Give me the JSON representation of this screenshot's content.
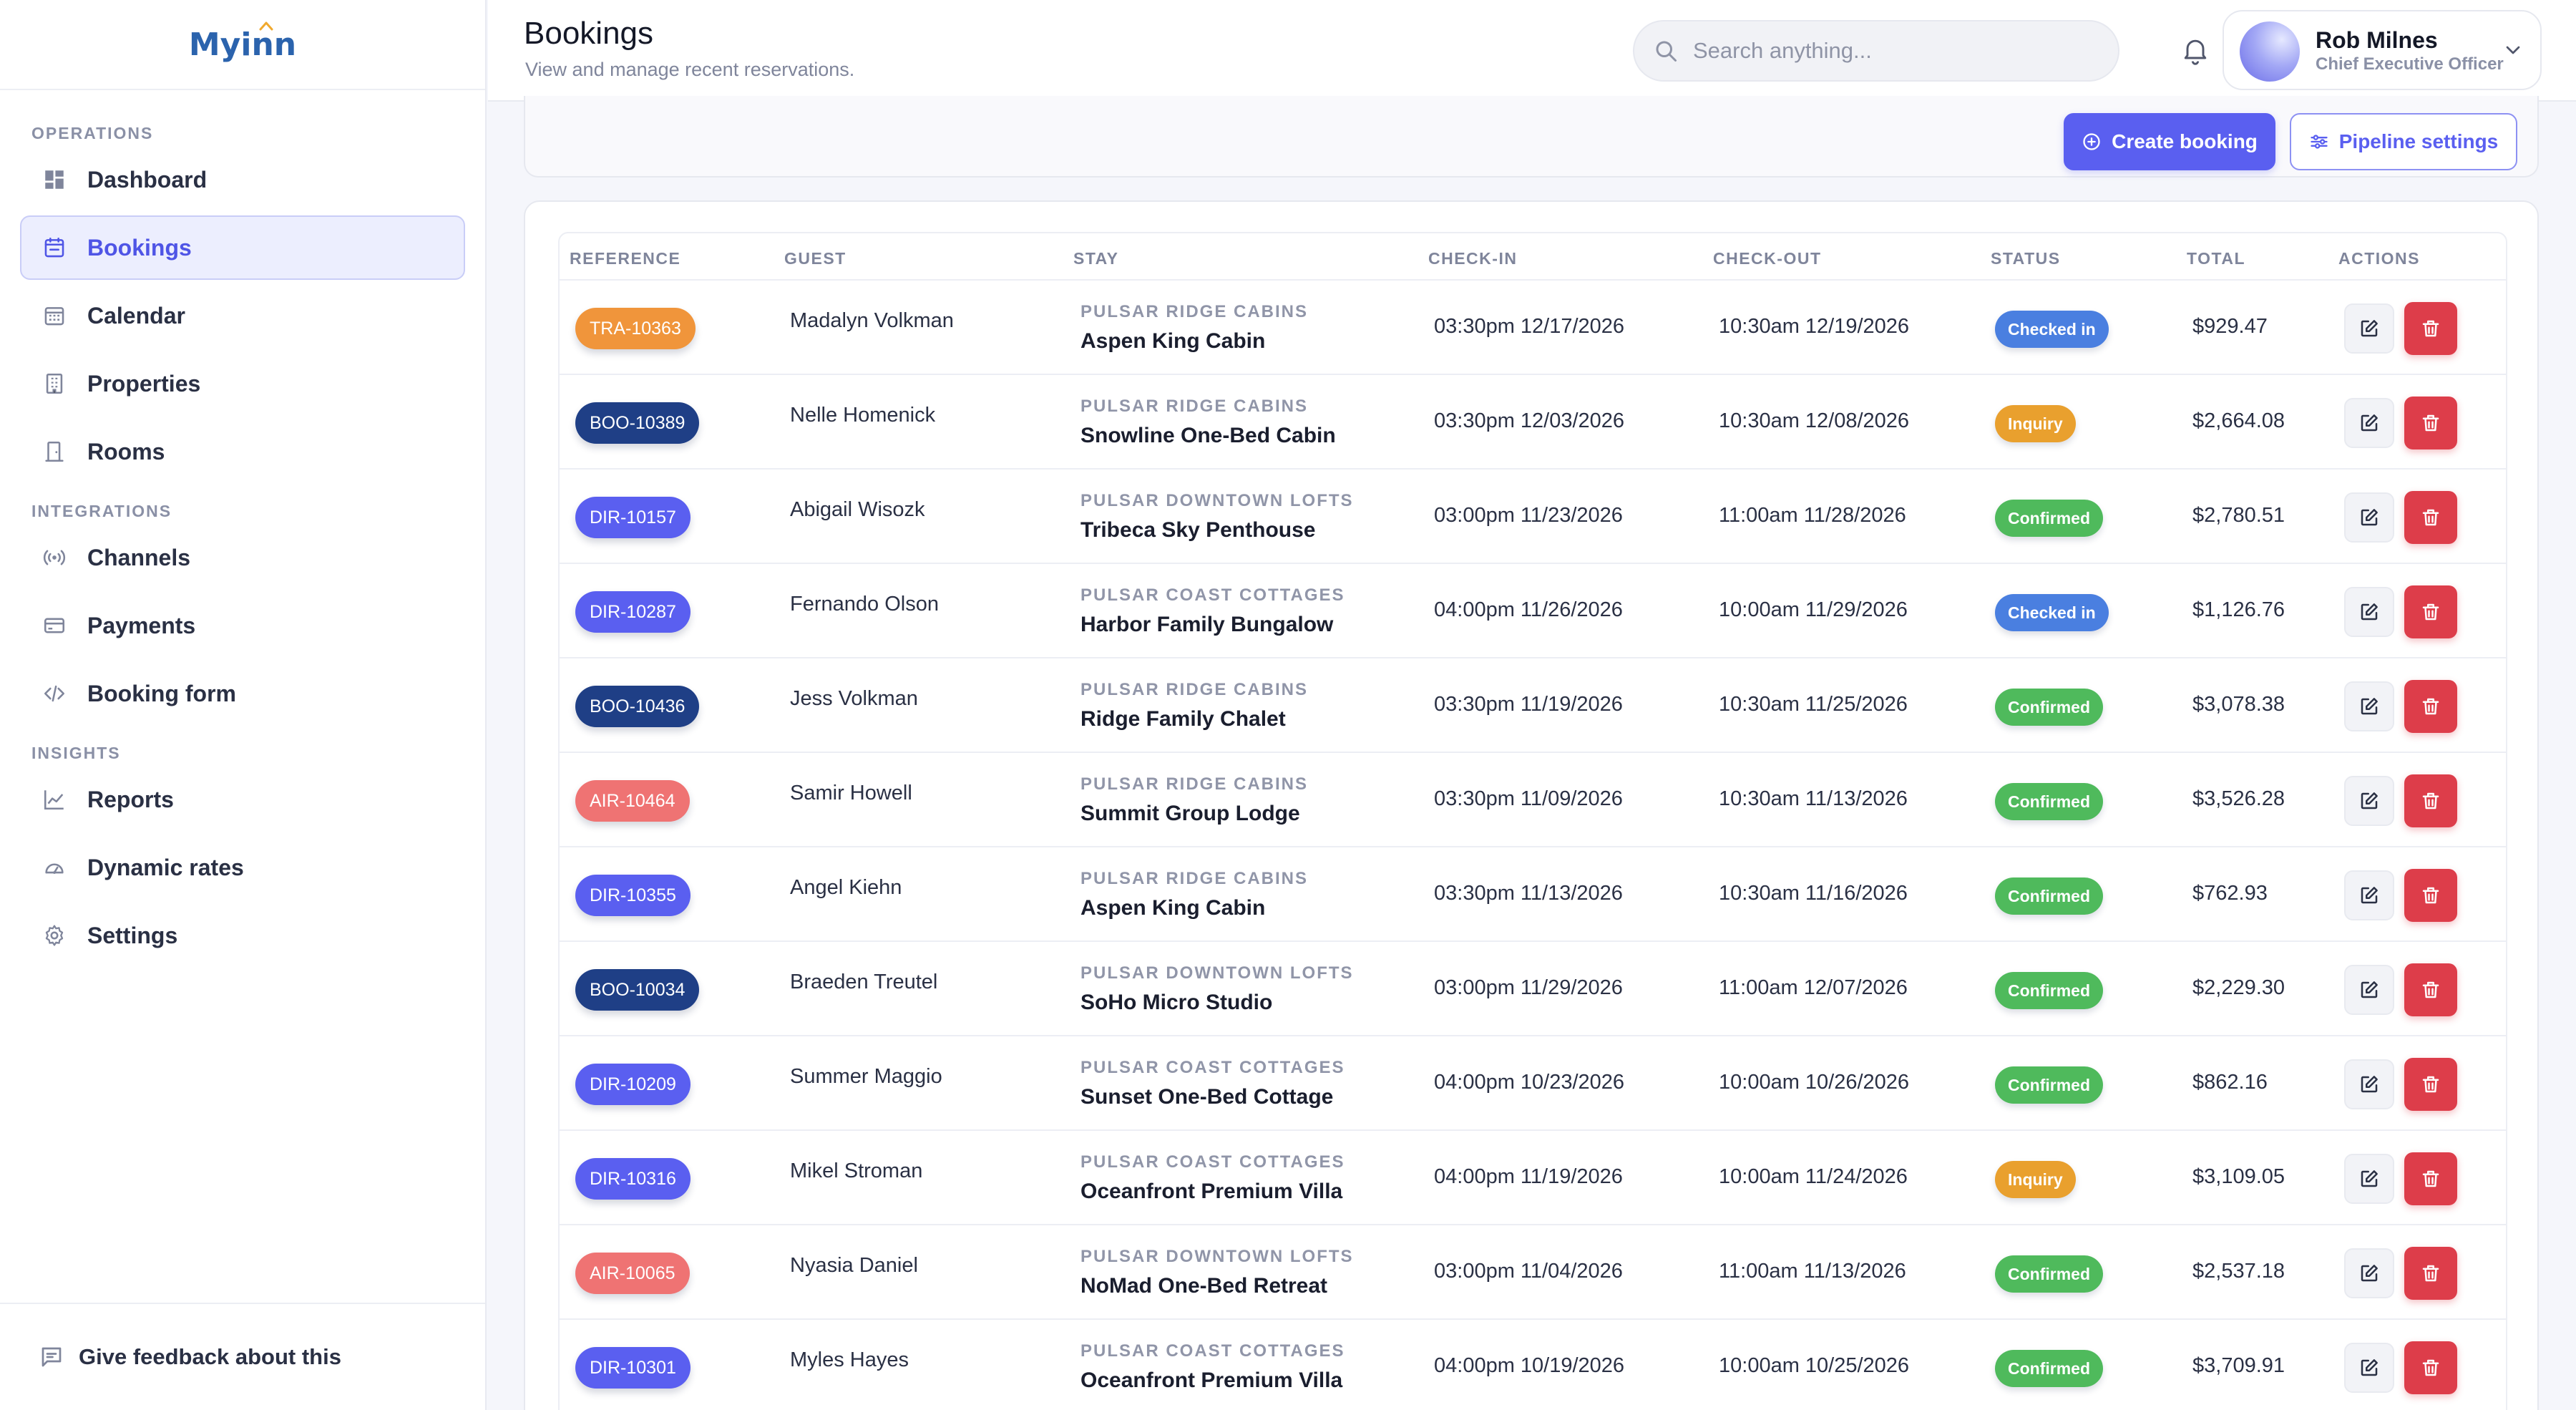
{
  "app": {
    "logo_text": "Myinn",
    "feedback_label": "Give feedback about this"
  },
  "sidebar": {
    "sections": [
      {
        "title": "OPERATIONS",
        "items": [
          {
            "label": "Dashboard",
            "icon": "dashboard-icon",
            "active": false
          },
          {
            "label": "Bookings",
            "icon": "bookings-icon",
            "active": true
          },
          {
            "label": "Calendar",
            "icon": "calendar-icon",
            "active": false
          },
          {
            "label": "Properties",
            "icon": "building-icon",
            "active": false
          },
          {
            "label": "Rooms",
            "icon": "door-icon",
            "active": false
          }
        ]
      },
      {
        "title": "INTEGRATIONS",
        "items": [
          {
            "label": "Channels",
            "icon": "broadcast-icon",
            "active": false
          },
          {
            "label": "Payments",
            "icon": "credit-card-icon",
            "active": false
          },
          {
            "label": "Booking form",
            "icon": "code-icon",
            "active": false
          }
        ]
      },
      {
        "title": "INSIGHTS",
        "items": [
          {
            "label": "Reports",
            "icon": "chart-line-icon",
            "active": false
          },
          {
            "label": "Dynamic rates",
            "icon": "gauge-icon",
            "active": false
          },
          {
            "label": "Settings",
            "icon": "gear-icon",
            "active": false
          }
        ]
      }
    ]
  },
  "header": {
    "title": "Bookings",
    "subtitle": "View and manage recent reservations.",
    "search_placeholder": "Search anything...",
    "user": {
      "name": "Rob Milnes",
      "role": "Chief Executive Officer"
    }
  },
  "actions": {
    "create_label": "Create booking",
    "pipeline_label": "Pipeline settings"
  },
  "table": {
    "columns": [
      "REFERENCE",
      "GUEST",
      "STAY",
      "CHECK-IN",
      "CHECK-OUT",
      "STATUS",
      "TOTAL",
      "ACTIONS"
    ],
    "rows": [
      {
        "ref": "TRA-10363",
        "ref_color": "#f0953b",
        "guest": "Madalyn Volkman",
        "property": "PULSAR RIDGE CABINS",
        "room": "Aspen King Cabin",
        "checkin": "03:30pm 12/17/2026",
        "checkout": "10:30am 12/19/2026",
        "status": "Checked in",
        "status_color": "#4a7fe0",
        "total": "$929.47"
      },
      {
        "ref": "BOO-10389",
        "ref_color": "#1f3f86",
        "guest": "Nelle Homenick",
        "property": "PULSAR RIDGE CABINS",
        "room": "Snowline One-Bed Cabin",
        "checkin": "03:30pm 12/03/2026",
        "checkout": "10:30am 12/08/2026",
        "status": "Inquiry",
        "status_color": "#e9a02e",
        "total": "$2,664.08"
      },
      {
        "ref": "DIR-10157",
        "ref_color": "#5a5ff0",
        "guest": "Abigail Wisozk",
        "property": "PULSAR DOWNTOWN LOFTS",
        "room": "Tribeca Sky Penthouse",
        "checkin": "03:00pm 11/23/2026",
        "checkout": "11:00am 11/28/2026",
        "status": "Confirmed",
        "status_color": "#4fba5c",
        "total": "$2,780.51"
      },
      {
        "ref": "DIR-10287",
        "ref_color": "#5a5ff0",
        "guest": "Fernando Olson",
        "property": "PULSAR COAST COTTAGES",
        "room": "Harbor Family Bungalow",
        "checkin": "04:00pm 11/26/2026",
        "checkout": "10:00am 11/29/2026",
        "status": "Checked in",
        "status_color": "#4a7fe0",
        "total": "$1,126.76"
      },
      {
        "ref": "BOO-10436",
        "ref_color": "#1f3f86",
        "guest": "Jess Volkman",
        "property": "PULSAR RIDGE CABINS",
        "room": "Ridge Family Chalet",
        "checkin": "03:30pm 11/19/2026",
        "checkout": "10:30am 11/25/2026",
        "status": "Confirmed",
        "status_color": "#4fba5c",
        "total": "$3,078.38"
      },
      {
        "ref": "AIR-10464",
        "ref_color": "#ef7373",
        "guest": "Samir Howell",
        "property": "PULSAR RIDGE CABINS",
        "room": "Summit Group Lodge",
        "checkin": "03:30pm 11/09/2026",
        "checkout": "10:30am 11/13/2026",
        "status": "Confirmed",
        "status_color": "#4fba5c",
        "total": "$3,526.28"
      },
      {
        "ref": "DIR-10355",
        "ref_color": "#5a5ff0",
        "guest": "Angel Kiehn",
        "property": "PULSAR RIDGE CABINS",
        "room": "Aspen King Cabin",
        "checkin": "03:30pm 11/13/2026",
        "checkout": "10:30am 11/16/2026",
        "status": "Confirmed",
        "status_color": "#4fba5c",
        "total": "$762.93"
      },
      {
        "ref": "BOO-10034",
        "ref_color": "#1f3f86",
        "guest": "Braeden Treutel",
        "property": "PULSAR DOWNTOWN LOFTS",
        "room": "SoHo Micro Studio",
        "checkin": "03:00pm 11/29/2026",
        "checkout": "11:00am 12/07/2026",
        "status": "Confirmed",
        "status_color": "#4fba5c",
        "total": "$2,229.30"
      },
      {
        "ref": "DIR-10209",
        "ref_color": "#5a5ff0",
        "guest": "Summer Maggio",
        "property": "PULSAR COAST COTTAGES",
        "room": "Sunset One-Bed Cottage",
        "checkin": "04:00pm 10/23/2026",
        "checkout": "10:00am 10/26/2026",
        "status": "Confirmed",
        "status_color": "#4fba5c",
        "total": "$862.16"
      },
      {
        "ref": "DIR-10316",
        "ref_color": "#5a5ff0",
        "guest": "Mikel Stroman",
        "property": "PULSAR COAST COTTAGES",
        "room": "Oceanfront Premium Villa",
        "checkin": "04:00pm 11/19/2026",
        "checkout": "10:00am 11/24/2026",
        "status": "Inquiry",
        "status_color": "#e9a02e",
        "total": "$3,109.05"
      },
      {
        "ref": "AIR-10065",
        "ref_color": "#ef7373",
        "guest": "Nyasia Daniel",
        "property": "PULSAR DOWNTOWN LOFTS",
        "room": "NoMad One-Bed Retreat",
        "checkin": "03:00pm 11/04/2026",
        "checkout": "11:00am 11/13/2026",
        "status": "Confirmed",
        "status_color": "#4fba5c",
        "total": "$2,537.18"
      },
      {
        "ref": "DIR-10301",
        "ref_color": "#5a5ff0",
        "guest": "Myles Hayes",
        "property": "PULSAR COAST COTTAGES",
        "room": "Oceanfront Premium Villa",
        "checkin": "04:00pm 10/19/2026",
        "checkout": "10:00am 10/25/2026",
        "status": "Confirmed",
        "status_color": "#4fba5c",
        "total": "$3,709.91"
      }
    ]
  }
}
